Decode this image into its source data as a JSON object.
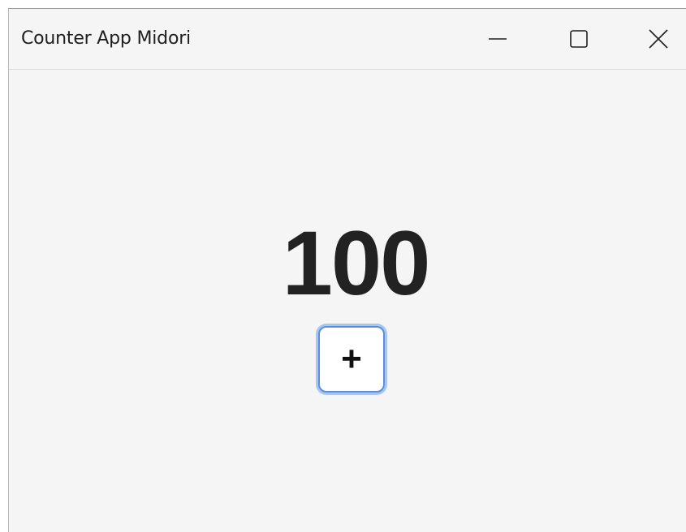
{
  "window": {
    "title": "Counter App Midori"
  },
  "titlebar_controls": {
    "minimize_icon": "minimize-icon",
    "maximize_icon": "maximize-icon",
    "close_icon": "close-icon"
  },
  "counter": {
    "value": "100",
    "increment_label": "+"
  },
  "colors": {
    "background": "#f5f5f5",
    "button_border": "#5b8fd9",
    "button_focus_ring": "#a9c6f2",
    "text": "#222222"
  }
}
